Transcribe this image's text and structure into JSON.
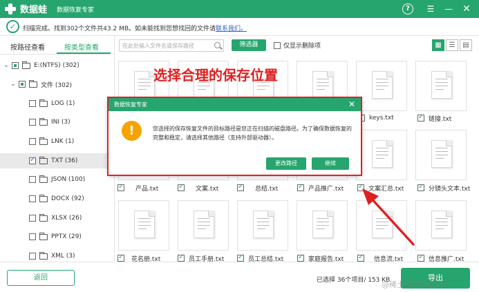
{
  "titlebar": {
    "logo": "数据蛙",
    "subtitle": "数据恢复专家",
    "help": "?",
    "menu": "☰",
    "minimize": "—",
    "close": "✕"
  },
  "status": {
    "text": "扫描完成。找到302个文件共43.2 MB。如未能找到您想找回的文件请",
    "link": "联系我们。"
  },
  "tabs": [
    {
      "label": "按路径查看"
    },
    {
      "label": "按类型查看"
    }
  ],
  "tree": [
    {
      "label": "E:(NTFS) (302)"
    },
    {
      "label": "文件 (302)"
    },
    {
      "label": "LOG (1)"
    },
    {
      "label": "INI (3)"
    },
    {
      "label": "LNK (1)"
    },
    {
      "label": "TXT (36)"
    },
    {
      "label": "JSON (100)"
    },
    {
      "label": "DOCX (92)"
    },
    {
      "label": "XLSX (26)"
    },
    {
      "label": "PPTX (29)"
    },
    {
      "label": "XML (3)"
    }
  ],
  "toolbar": {
    "search_placeholder": "在此处输入文件名或保存路径",
    "filter": "筛选器",
    "only_deleted": "仅显示删除项"
  },
  "files_row1": [
    {
      "name": ""
    },
    {
      "name": ""
    },
    {
      "name": ""
    },
    {
      "name": ""
    },
    {
      "name": "keys.txt"
    },
    {
      "name": "链接.txt"
    }
  ],
  "files_row2": [
    {
      "name": "产品.txt"
    },
    {
      "name": "文案.txt"
    },
    {
      "name": "总结.txt"
    },
    {
      "name": "产品推广.txt"
    },
    {
      "name": "文案汇总.txt"
    },
    {
      "name": "分镜头文本.txt"
    }
  ],
  "files_row3": [
    {
      "name": "花名册.txt"
    },
    {
      "name": "员工手册.txt"
    },
    {
      "name": "员工总结.txt"
    },
    {
      "name": "家庭报告.txt"
    },
    {
      "name": "信息流.txt"
    },
    {
      "name": "信息推广.txt"
    }
  ],
  "annotation": "选择合理的保存位置",
  "dialog": {
    "title": "数据恢复专家",
    "message": "您选择的保存恢复文件的目标路径是您正在扫描的磁盘路径。为了确保数据恢复的完整和稳定，请选择其他路径（支持外部驱动器）。",
    "change_path": "更改路径",
    "continue": "继续"
  },
  "bottom": {
    "back": "返回",
    "selected": "已选择 36个项目/ 153 KB",
    "export": "导出",
    "watermark": "@稀土掘金技术社区"
  },
  "colors": {
    "brand": "#27a56f",
    "annotation": "#e02020",
    "warning": "#f4a300",
    "link": "#2b62c8"
  }
}
